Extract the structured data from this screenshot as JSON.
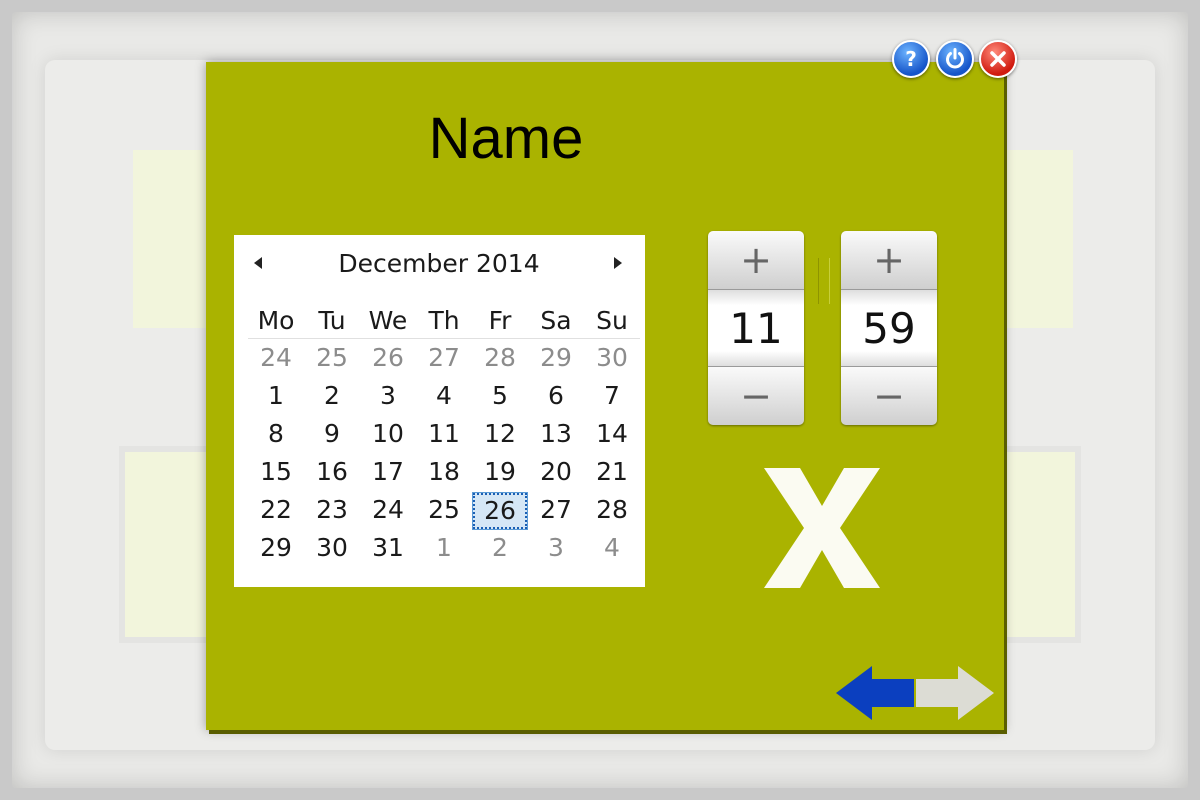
{
  "dialog": {
    "title": "Name"
  },
  "top_buttons": {
    "help_label": "?"
  },
  "calendar": {
    "month_title": "December 2014",
    "weekdays": [
      "Mo",
      "Tu",
      "We",
      "Th",
      "Fr",
      "Sa",
      "Su"
    ],
    "days": [
      {
        "label": "24",
        "current": false
      },
      {
        "label": "25",
        "current": false
      },
      {
        "label": "26",
        "current": false
      },
      {
        "label": "27",
        "current": false
      },
      {
        "label": "28",
        "current": false
      },
      {
        "label": "29",
        "current": false
      },
      {
        "label": "30",
        "current": false
      },
      {
        "label": "1",
        "current": true
      },
      {
        "label": "2",
        "current": true
      },
      {
        "label": "3",
        "current": true
      },
      {
        "label": "4",
        "current": true
      },
      {
        "label": "5",
        "current": true
      },
      {
        "label": "6",
        "current": true
      },
      {
        "label": "7",
        "current": true
      },
      {
        "label": "8",
        "current": true
      },
      {
        "label": "9",
        "current": true
      },
      {
        "label": "10",
        "current": true
      },
      {
        "label": "11",
        "current": true
      },
      {
        "label": "12",
        "current": true
      },
      {
        "label": "13",
        "current": true
      },
      {
        "label": "14",
        "current": true
      },
      {
        "label": "15",
        "current": true
      },
      {
        "label": "16",
        "current": true
      },
      {
        "label": "17",
        "current": true
      },
      {
        "label": "18",
        "current": true
      },
      {
        "label": "19",
        "current": true
      },
      {
        "label": "20",
        "current": true
      },
      {
        "label": "21",
        "current": true
      },
      {
        "label": "22",
        "current": true
      },
      {
        "label": "23",
        "current": true
      },
      {
        "label": "24",
        "current": true
      },
      {
        "label": "25",
        "current": true
      },
      {
        "label": "26",
        "current": true,
        "selected": true
      },
      {
        "label": "27",
        "current": true
      },
      {
        "label": "28",
        "current": true
      },
      {
        "label": "29",
        "current": true
      },
      {
        "label": "30",
        "current": true
      },
      {
        "label": "31",
        "current": true
      },
      {
        "label": "1",
        "current": false
      },
      {
        "label": "2",
        "current": false
      },
      {
        "label": "3",
        "current": false
      },
      {
        "label": "4",
        "current": false
      }
    ]
  },
  "time": {
    "hours": "11",
    "minutes": "59",
    "plus_label": "+",
    "minus_label": "−"
  },
  "icons": {
    "help": "help-icon",
    "power": "power-icon",
    "close": "close-icon",
    "clear": "clear-x-icon",
    "back": "arrow-left-icon",
    "forward": "arrow-right-icon"
  },
  "colors": {
    "dialog_bg": "#aab300",
    "accent_blue": "#1655c9",
    "close_red": "#d01a0f",
    "selected_day_bg": "#d5e7f6"
  }
}
